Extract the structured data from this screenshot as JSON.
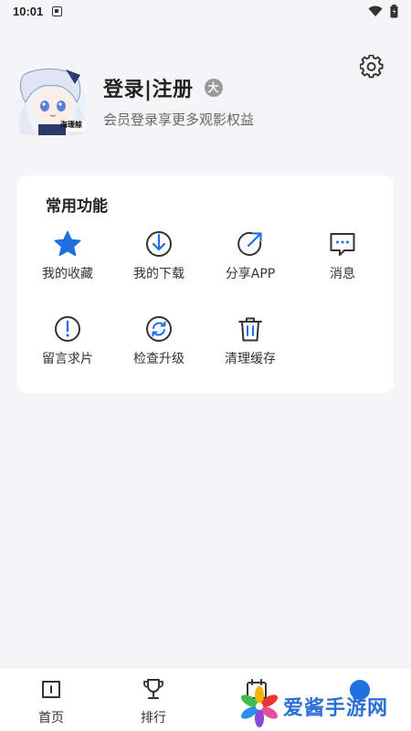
{
  "status_bar": {
    "time": "10:01"
  },
  "profile": {
    "name": "登录|注册",
    "badge": "大",
    "subtitle": "会员登录享更多观影权益",
    "avatar_caption": "海珊鲸"
  },
  "functions": {
    "title": "常用功能",
    "items": [
      {
        "label": "我的收藏",
        "icon": "star-icon"
      },
      {
        "label": "我的下载",
        "icon": "download-icon"
      },
      {
        "label": "分享APP",
        "icon": "share-icon"
      },
      {
        "label": "消息",
        "icon": "message-icon"
      },
      {
        "label": "留言求片",
        "icon": "exclamation-icon"
      },
      {
        "label": "检查升级",
        "icon": "refresh-icon"
      },
      {
        "label": "清理缓存",
        "icon": "trash-icon"
      }
    ]
  },
  "tabbar": {
    "tabs": [
      {
        "label": "首页",
        "icon": "home-icon"
      },
      {
        "label": "排行",
        "icon": "trophy-icon"
      },
      {
        "label": "",
        "icon": "calendar-icon"
      },
      {
        "label": "",
        "icon": "profile-icon"
      }
    ]
  },
  "watermark": {
    "text": "爱酱手游网"
  },
  "colors": {
    "accent": "#1e6fe0",
    "card_bg": "#ffffff",
    "page_bg": "#f5f5f7"
  }
}
